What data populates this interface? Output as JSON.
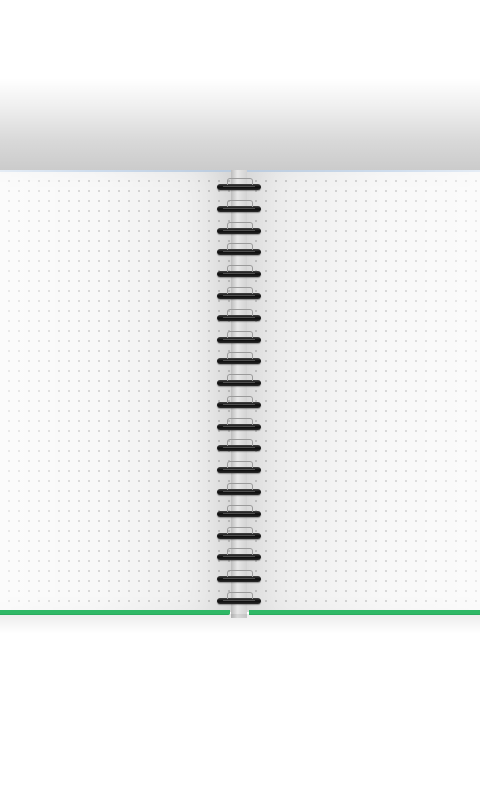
{
  "scene": {
    "subject": "open-spiral-notebook",
    "page_pattern": "dot-grid",
    "ring_count": 20,
    "colors": {
      "background": "#ffffff",
      "page": "#f7f7f7",
      "dot": "#c9c9c9",
      "cover_edge": "#2fb866",
      "page_top_edge": "#c5d6ea",
      "ring": "#111111"
    }
  }
}
